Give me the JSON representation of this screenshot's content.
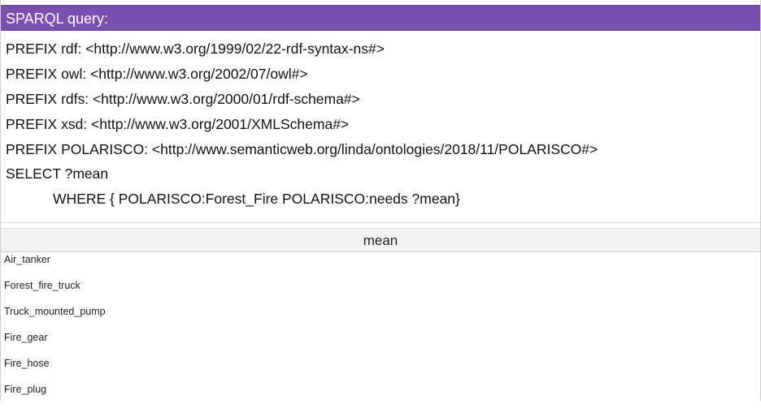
{
  "header": {
    "title": "SPARQL query:",
    "color": "#7a4fae"
  },
  "query": {
    "lines": [
      "PREFIX rdf: <http://www.w3.org/1999/02/22-rdf-syntax-ns#>",
      "PREFIX owl: <http://www.w3.org/2002/07/owl#>",
      "PREFIX rdfs: <http://www.w3.org/2000/01/rdf-schema#>",
      "PREFIX xsd: <http://www.w3.org/2001/XMLSchema#>",
      "PREFIX POLARISCO: <http://www.semanticweb.org/linda/ontologies/2018/11/POLARISCO#>",
      "SELECT ?mean",
      "WHERE { POLARISCO:Forest_Fire POLARISCO:needs ?mean}"
    ]
  },
  "results": {
    "column": "mean",
    "rows": [
      "Air_tanker",
      "Forest_fire_truck",
      "Truck_mounted_pump",
      "Fire_gear",
      "Fire_hose",
      "Fire_plug"
    ]
  }
}
